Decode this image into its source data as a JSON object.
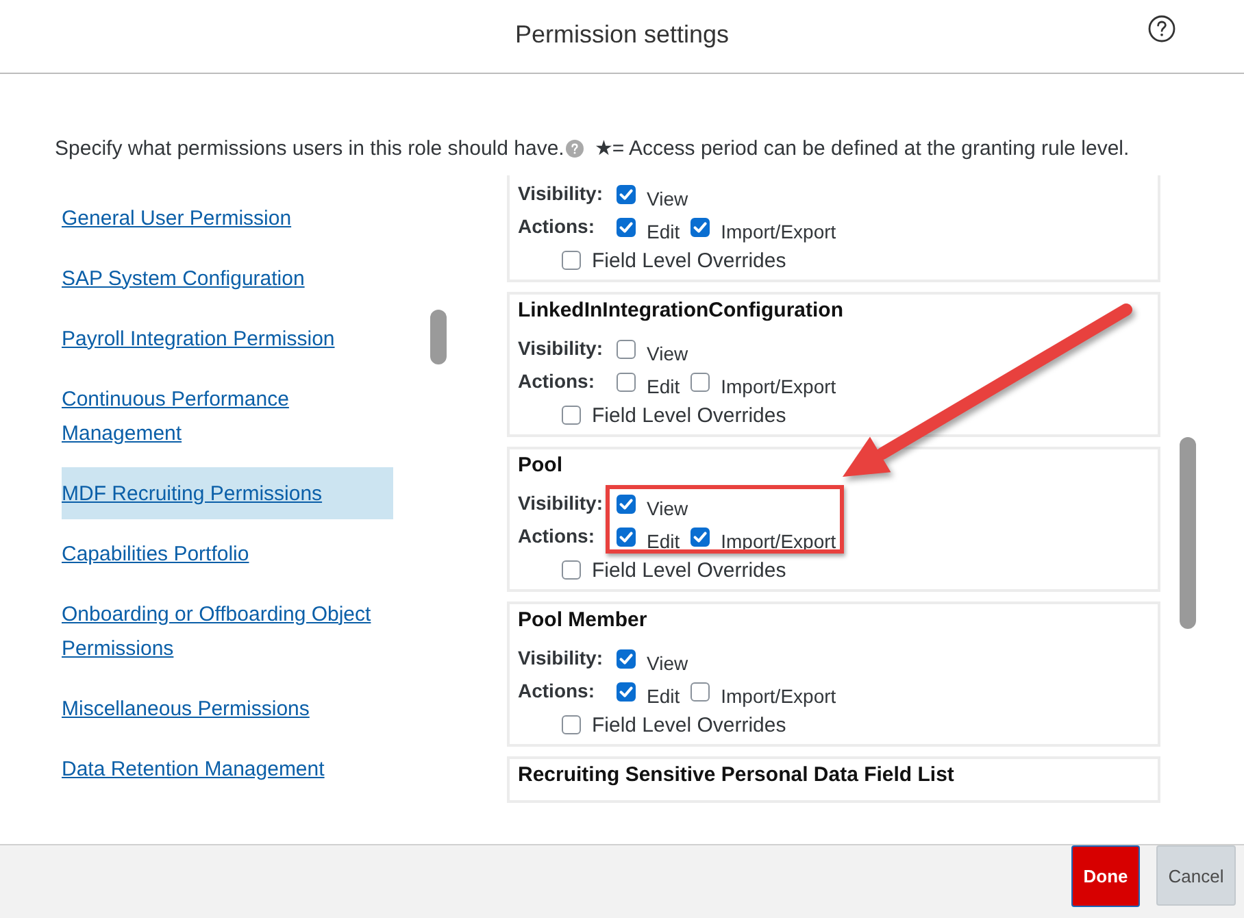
{
  "dialog": {
    "title": "Permission settings"
  },
  "intro": {
    "text": "Specify what permissions users in this role should have.",
    "note": "★= Access period can be defined at the granting rule level."
  },
  "categories": [
    {
      "label": "General User Permission",
      "selected": false
    },
    {
      "label": "SAP System Configuration",
      "selected": false
    },
    {
      "label": "Payroll Integration Permission",
      "selected": false
    },
    {
      "label": "Continuous Performance Management",
      "selected": false
    },
    {
      "label": "MDF Recruiting Permissions",
      "selected": true
    },
    {
      "label": "Capabilities Portfolio",
      "selected": false
    },
    {
      "label": "Onboarding or Offboarding Object Permissions",
      "selected": false
    },
    {
      "label": "Miscellaneous Permissions",
      "selected": false
    },
    {
      "label": "Data Retention Management",
      "selected": false
    }
  ],
  "sections": [
    {
      "highlighted": false,
      "rows": [
        {
          "label": "Visibility:",
          "options": [
            {
              "label": "View",
              "checked": true
            }
          ]
        },
        {
          "label": "Actions:",
          "options": [
            {
              "label": "Edit",
              "checked": true
            },
            {
              "label": "Import/Export",
              "checked": true
            }
          ]
        }
      ],
      "field_level_overrides": {
        "label": "Field Level Overrides",
        "checked": false
      }
    },
    {
      "title": "LinkedInIntegrationConfiguration",
      "highlighted": false,
      "rows": [
        {
          "label": "Visibility:",
          "options": [
            {
              "label": "View",
              "checked": false
            }
          ]
        },
        {
          "label": "Actions:",
          "options": [
            {
              "label": "Edit",
              "checked": false
            },
            {
              "label": "Import/Export",
              "checked": false
            }
          ]
        }
      ],
      "field_level_overrides": {
        "label": "Field Level Overrides",
        "checked": false
      }
    },
    {
      "title": "Pool",
      "highlighted": true,
      "rows": [
        {
          "label": "Visibility:",
          "options": [
            {
              "label": "View",
              "checked": true
            }
          ]
        },
        {
          "label": "Actions:",
          "options": [
            {
              "label": "Edit",
              "checked": true
            },
            {
              "label": "Import/Export",
              "checked": true
            }
          ]
        }
      ],
      "field_level_overrides": {
        "label": "Field Level Overrides",
        "checked": false
      }
    },
    {
      "title": "Pool Member",
      "highlighted": false,
      "rows": [
        {
          "label": "Visibility:",
          "options": [
            {
              "label": "View",
              "checked": true
            }
          ]
        },
        {
          "label": "Actions:",
          "options": [
            {
              "label": "Edit",
              "checked": true
            },
            {
              "label": "Import/Export",
              "checked": false
            }
          ]
        }
      ],
      "field_level_overrides": {
        "label": "Field Level Overrides",
        "checked": false
      }
    },
    {
      "title": "Recruiting Sensitive Personal Data Field List"
    }
  ],
  "buttons": [
    {
      "label": "Done",
      "kind": "primary"
    },
    {
      "label": "Cancel",
      "kind": "secondary"
    }
  ]
}
